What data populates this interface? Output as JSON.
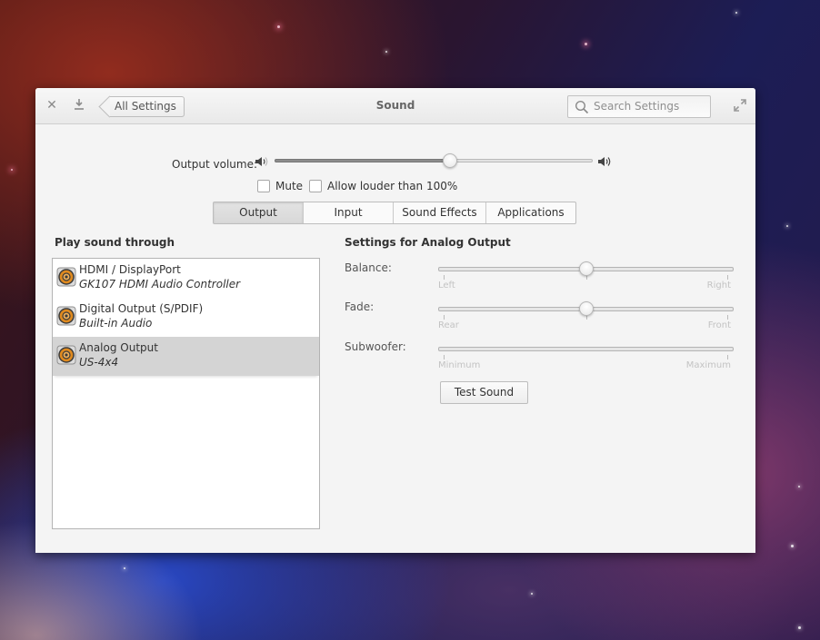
{
  "window": {
    "title": "Sound",
    "back_button": "All Settings",
    "search_placeholder": "Search Settings",
    "icons": {
      "close": "close-icon",
      "download": "download-icon",
      "maximize": "maximize-icon",
      "search": "search-icon"
    }
  },
  "output_volume": {
    "label": "Output volume:",
    "value_percent": 55,
    "low_icon": "speaker-low-icon",
    "high_icon": "speaker-high-icon"
  },
  "checkboxes": [
    {
      "label": "Mute",
      "checked": false
    },
    {
      "label": "Allow louder than 100%",
      "checked": false
    }
  ],
  "tabs": [
    {
      "label": "Output",
      "active": true
    },
    {
      "label": "Input",
      "active": false
    },
    {
      "label": "Sound Effects",
      "active": false
    },
    {
      "label": "Applications",
      "active": false
    }
  ],
  "play_through": {
    "heading": "Play sound through",
    "devices": [
      {
        "name": "HDMI / DisplayPort",
        "description": "GK107 HDMI Audio Controller",
        "icon": "speaker-icon",
        "selected": false
      },
      {
        "name": "Digital Output (S/PDIF)",
        "description": "Built-in Audio",
        "icon": "speaker-icon",
        "selected": false
      },
      {
        "name": "Analog Output",
        "description": "US-4x4",
        "icon": "speaker-icon",
        "selected": true
      }
    ]
  },
  "device_settings": {
    "heading": "Settings for Analog Output",
    "sliders": [
      {
        "label": "Balance:",
        "min_label": "Left",
        "max_label": "Right",
        "value_fraction": 0.5,
        "has_knob": true
      },
      {
        "label": "Fade:",
        "min_label": "Rear",
        "max_label": "Front",
        "value_fraction": 0.5,
        "has_knob": true
      },
      {
        "label": "Subwoofer:",
        "min_label": "Minimum",
        "max_label": "Maximum",
        "value_fraction": null,
        "has_knob": false
      }
    ],
    "test_button": "Test Sound"
  }
}
